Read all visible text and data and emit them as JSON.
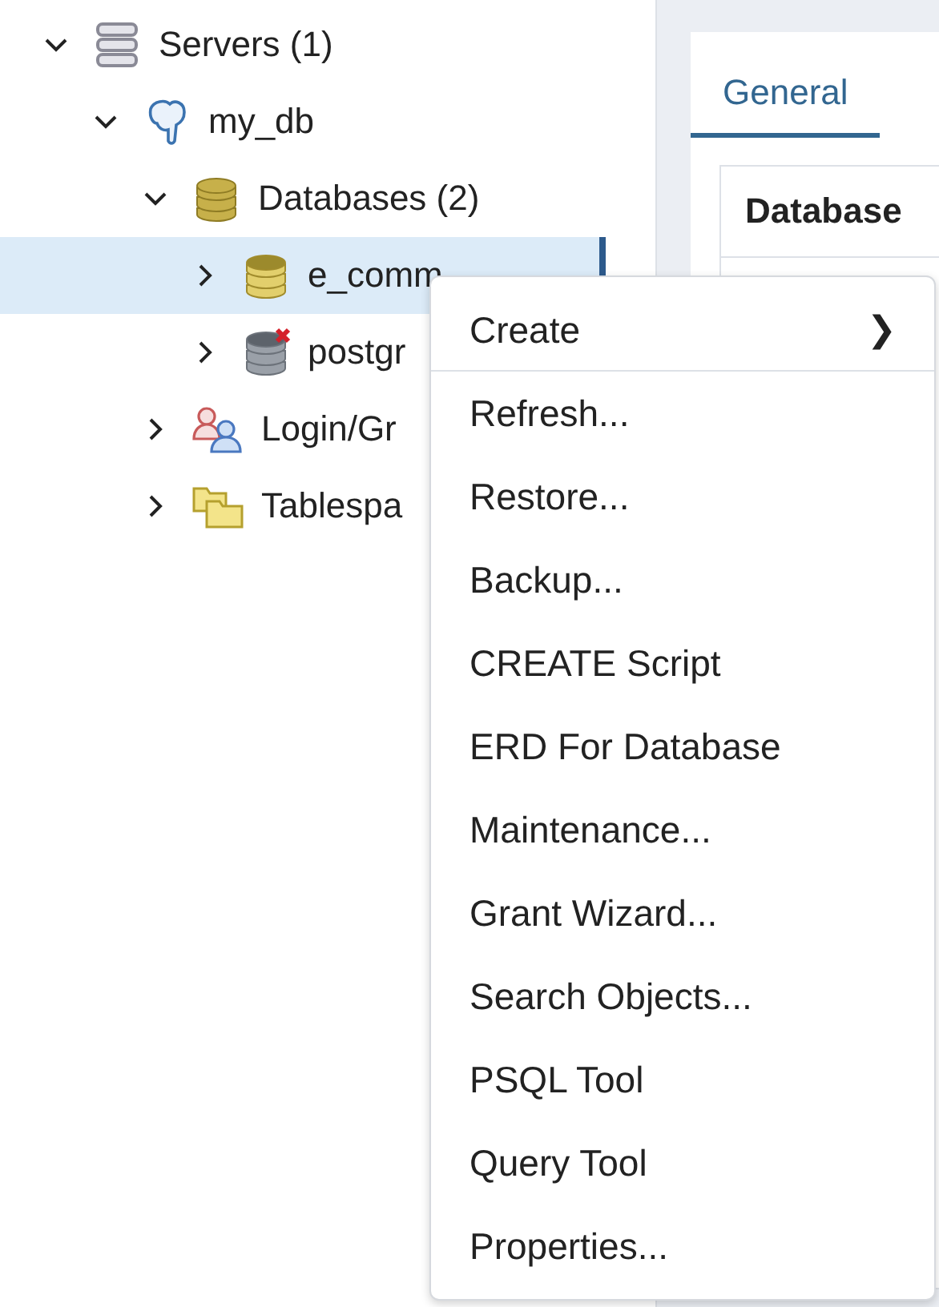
{
  "tree": [
    {
      "label": "Servers (1)",
      "kind": "servers",
      "expanded": true,
      "selected": false,
      "children": [
        {
          "label": "my_db",
          "kind": "server",
          "expanded": true,
          "selected": false,
          "children": [
            {
              "label": "Databases (2)",
              "kind": "databases",
              "expanded": true,
              "selected": false,
              "children": [
                {
                  "label": "e_comm",
                  "kind": "database",
                  "expanded": false,
                  "selected": true
                },
                {
                  "label": "postgr",
                  "kind": "database-disconnected",
                  "expanded": false,
                  "selected": false
                }
              ]
            },
            {
              "label": "Login/Gr",
              "kind": "roles",
              "expanded": false,
              "selected": false
            },
            {
              "label": "Tablespa",
              "kind": "tablespaces",
              "expanded": false,
              "selected": false
            }
          ]
        }
      ]
    }
  ],
  "detail": {
    "tabs": [
      {
        "label": "General",
        "selected": true
      }
    ],
    "card_title": "Database"
  },
  "context_menu": {
    "groups": [
      [
        {
          "label": "Create",
          "kind": "submenu",
          "arrow": "❯"
        }
      ],
      [
        {
          "label": "Refresh...",
          "kind": "action"
        },
        {
          "label": "Restore...",
          "kind": "action"
        },
        {
          "label": "Backup...",
          "kind": "action"
        },
        {
          "label": "CREATE Script",
          "kind": "action"
        },
        {
          "label": "ERD For Database",
          "kind": "action"
        },
        {
          "label": "Maintenance...",
          "kind": "action"
        },
        {
          "label": "Grant Wizard...",
          "kind": "action"
        },
        {
          "label": "Search Objects...",
          "kind": "action"
        },
        {
          "label": "PSQL Tool",
          "kind": "action"
        },
        {
          "label": "Query Tool",
          "kind": "action"
        },
        {
          "label": "Properties...",
          "kind": "action"
        }
      ]
    ]
  }
}
